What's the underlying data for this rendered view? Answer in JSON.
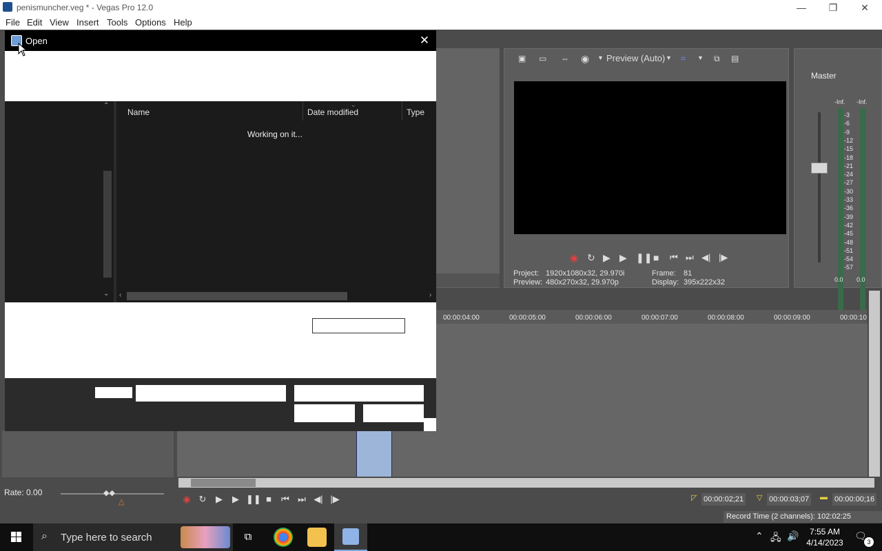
{
  "window": {
    "title": "penismuncher.veg * - Vegas Pro 12.0",
    "minimize": "—",
    "restore": "❐",
    "close": "✕"
  },
  "menu": [
    "File",
    "Edit",
    "View",
    "Insert",
    "Tools",
    "Options",
    "Help"
  ],
  "preview": {
    "mode_label": "Preview (Auto)",
    "project_label": "Project:",
    "project_value": "1920x1080x32, 29.970i",
    "preview_label": "Preview:",
    "preview_value": "480x270x32, 29.970p",
    "frame_label": "Frame:",
    "frame_value": "81",
    "display_label": "Display:",
    "display_value": "395x222x32"
  },
  "mixer": {
    "title": "Master",
    "inf_left": "-Inf.",
    "inf_right": "-Inf.",
    "scale": [
      "3",
      "6",
      "9",
      "12",
      "15",
      "18",
      "21",
      "24",
      "27",
      "30",
      "33",
      "36",
      "39",
      "42",
      "45",
      "48",
      "51",
      "54",
      "57"
    ],
    "level_left": "0.0",
    "level_right": "0.0"
  },
  "timeline": {
    "ticks": [
      "00:00:04:00",
      "00:00:05:00",
      "00:00:06:00",
      "00:00:07:00",
      "00:00:08:00",
      "00:00:09:00",
      "00:00:10"
    ],
    "rate": "Rate: 0.00",
    "tc_start": "00:00:02;21",
    "tc_end": "00:00:03;07",
    "tc_length": "00:00:00;16",
    "record_time": "Record Time (2 channels): 102:02:25"
  },
  "dialog": {
    "title": "Open",
    "close": "✕",
    "columns": [
      "Name",
      "Date modified",
      "Type"
    ],
    "status": "Working on it..."
  },
  "taskbar": {
    "search_placeholder": "Type here to search",
    "time": "7:55 AM",
    "date": "4/14/2023",
    "notifications": "3"
  }
}
